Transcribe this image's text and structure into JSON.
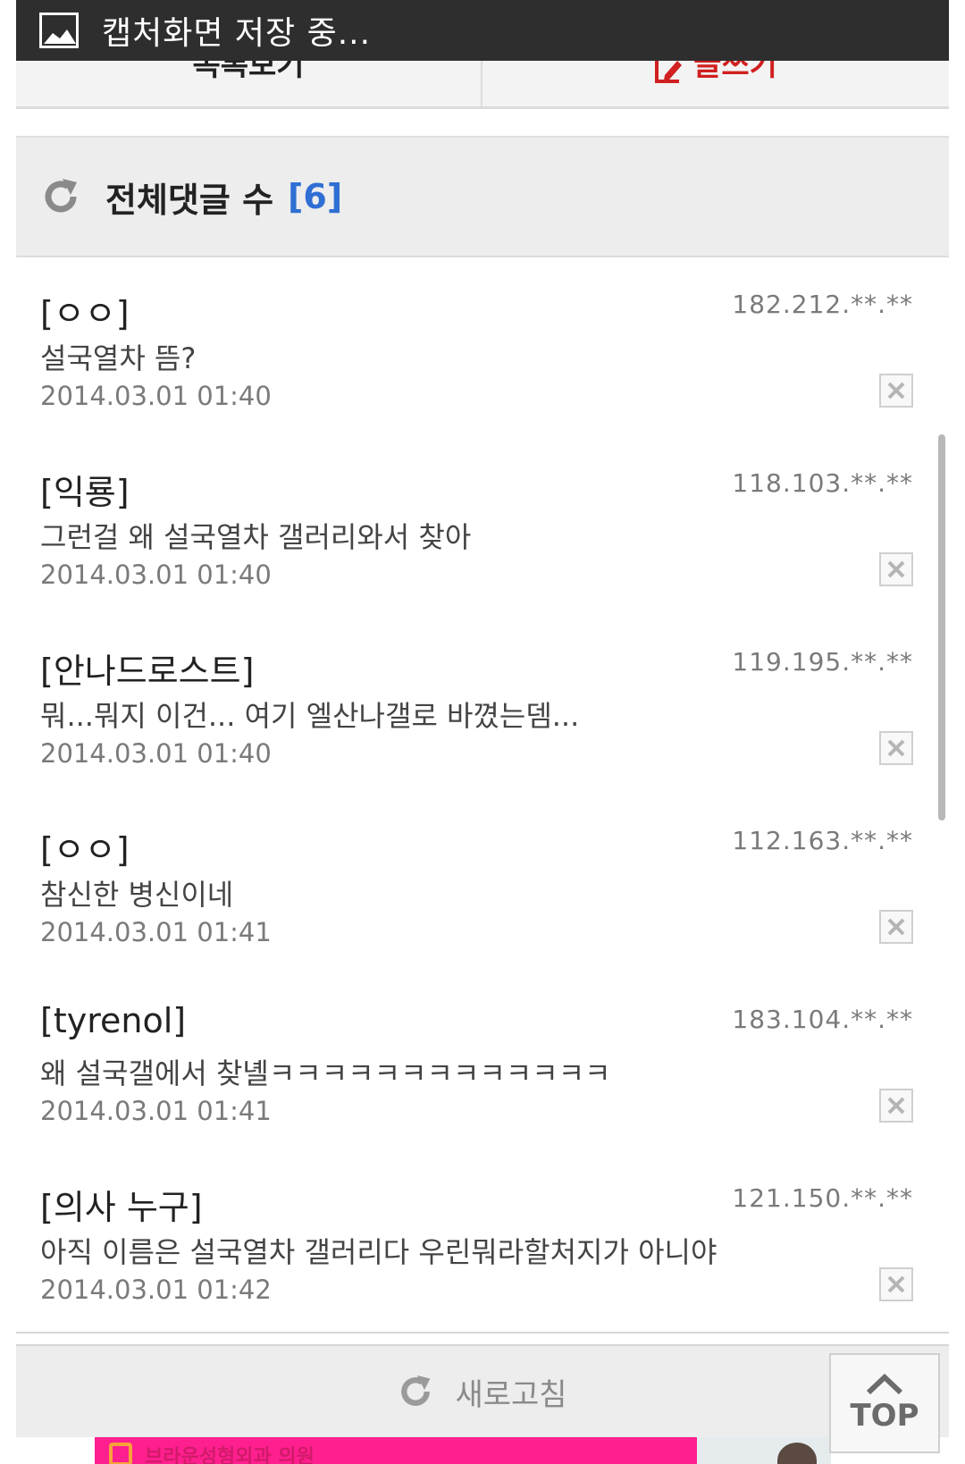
{
  "toast": {
    "text": "캡처화면 저장 중..."
  },
  "actions": {
    "list_label": "목록보기",
    "write_label": "글쓰기"
  },
  "comments_header": {
    "label": "전체댓글 수",
    "count": "[6]"
  },
  "comments": [
    {
      "author": "[ㅇㅇ]",
      "ip": "182.212.**.**",
      "body": "설국열차 뜸?",
      "date": "2014.03.01 01:40"
    },
    {
      "author": "[익룡]",
      "ip": "118.103.**.**",
      "body": "그런걸 왜 설국열차 갤러리와서 찾아",
      "date": "2014.03.01 01:40"
    },
    {
      "author": "[안나드로스트]",
      "ip": "119.195.**.**",
      "body": "뭐...뭐지 이건... 여기 엘산나갤로 바꼈는뎀...",
      "date": "2014.03.01 01:40"
    },
    {
      "author": "[ㅇㅇ]",
      "ip": "112.163.**.**",
      "body": "참신한 병신이네",
      "date": "2014.03.01 01:41"
    },
    {
      "author": "[tyrenol]",
      "ip": "183.104.**.**",
      "body": "왜 설국갤에서 찾녤ㅋㅋㅋㅋㅋㅋㅋㅋㅋㅋㅋㅋㅋ",
      "date": "2014.03.01 01:41"
    },
    {
      "author": "[의사 누구]",
      "ip": "121.150.**.**",
      "body": "아직 이름은 설국열차 갤러리다 우린뭐라할처지가 아니야",
      "date": "2014.03.01 01:42"
    }
  ],
  "refresh": {
    "label": "새로고침"
  },
  "top_button": {
    "label": "TOP"
  },
  "ad": {
    "text": "브라운성형외과 의원"
  },
  "colors": {
    "accent_blue": "#2f6fd3",
    "write_red": "#d0201f",
    "toast_bg": "#2e2e2e",
    "ad_pink": "#ff1f8e"
  }
}
